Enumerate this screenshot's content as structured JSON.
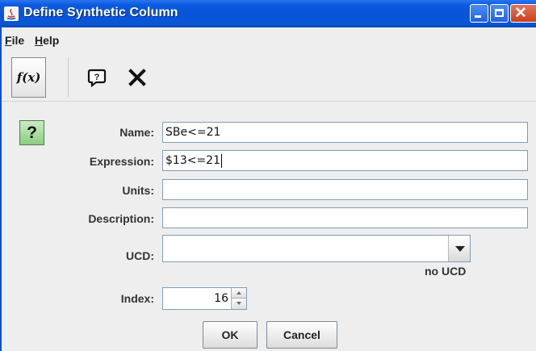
{
  "window": {
    "title": "Define Synthetic Column"
  },
  "menu": {
    "file": {
      "mnemonic": "F",
      "rest": "ile"
    },
    "help": {
      "mnemonic": "H",
      "rest": "elp"
    }
  },
  "toolbar": {
    "function_label": "f(x)",
    "help_glyph": "?",
    "close_glyph": "✕"
  },
  "help_button": {
    "glyph": "?"
  },
  "form": {
    "name": {
      "label": "Name:",
      "value": "SBe<=21"
    },
    "expression": {
      "label": "Expression:",
      "value": "$13<=21"
    },
    "units": {
      "label": "Units:",
      "value": ""
    },
    "description": {
      "label": "Description:",
      "value": ""
    },
    "ucd": {
      "label": "UCD:",
      "value": "",
      "status": "no UCD"
    },
    "index": {
      "label": "Index:",
      "value": "16"
    }
  },
  "buttons": {
    "ok": "OK",
    "cancel": "Cancel"
  },
  "colors": {
    "titlebar": "#0853d9",
    "help_green": "#8ccf80",
    "close_red": "#c8411f"
  }
}
